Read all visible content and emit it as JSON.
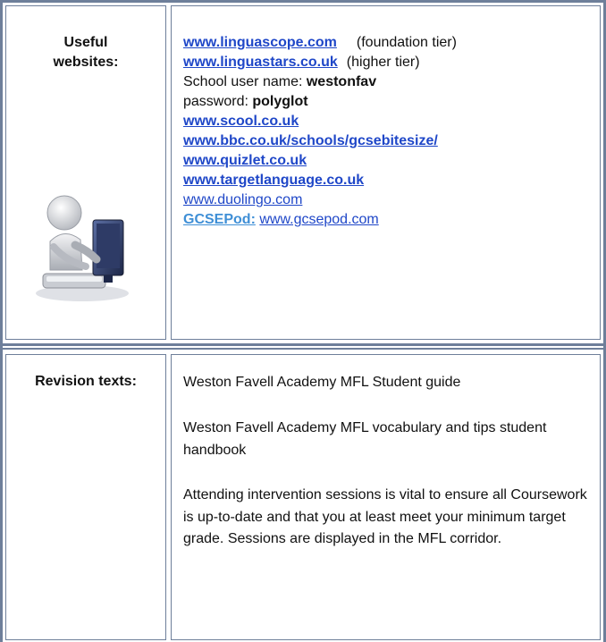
{
  "row1": {
    "label": "Useful websites:",
    "lines": {
      "linguascope": "www.linguascope.com",
      "linguascope_note": "(foundation tier)",
      "linguastars": "www.linguastars.co.uk",
      "linguastars_note": "(higher tier)",
      "user_label": "School user name: ",
      "user_value": "westonfav",
      "pass_label": "password: ",
      "pass_value": "polyglot",
      "scool": "www.scool.co.uk",
      "bitesize": "www.bbc.co.uk/schools/gcsebitesize/",
      "quizlet": "www.quizlet.co.uk",
      "targetlanguage": "www.targetlanguage.co.uk",
      "duolingo": "www.duolingo.com",
      "gcsepod_label": "GCSEPod:",
      "gcsepod_url": "www.gcsepod.com"
    },
    "figure_icon": "person-at-computer-icon"
  },
  "row2": {
    "label": "Revision texts:",
    "paragraphs": [
      "Weston Favell Academy MFL Student guide",
      "Weston Favell Academy MFL vocabulary and tips student handbook",
      "Attending intervention sessions is vital to ensure all Coursework is up-to-date and that you at least meet your minimum target grade. Sessions are displayed in the MFL corridor."
    ]
  },
  "colors": {
    "border": "#6e7f9a",
    "link": "#1f47c8",
    "gcsepod": "#3f8fd6"
  }
}
